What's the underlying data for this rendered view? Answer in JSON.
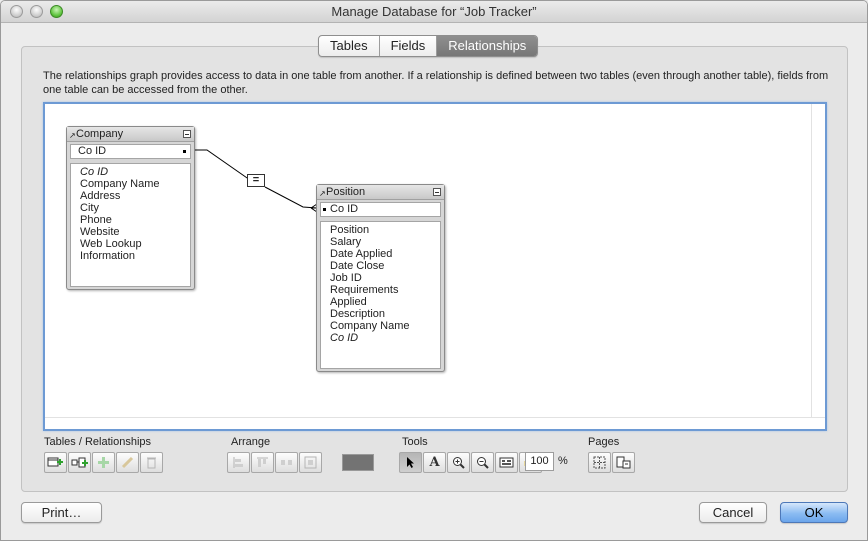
{
  "window": {
    "title": "Manage Database for “Job Tracker”"
  },
  "tabs": [
    {
      "label": "Tables",
      "active": false
    },
    {
      "label": "Fields",
      "active": false
    },
    {
      "label": "Relationships",
      "active": true
    }
  ],
  "description": "The relationships graph provides access to data in one table from another. If a relationship is defined between two tables (even through another table), fields from one table can be accessed from the other.",
  "graph": {
    "tables": [
      {
        "name": "Company",
        "key_field": "Co ID",
        "fields": [
          {
            "label": "Co ID",
            "italic": true
          },
          {
            "label": "Company Name",
            "italic": false
          },
          {
            "label": "Address",
            "italic": false
          },
          {
            "label": "City",
            "italic": false
          },
          {
            "label": "Phone",
            "italic": false
          },
          {
            "label": "Website",
            "italic": false
          },
          {
            "label": "Web Lookup",
            "italic": false
          },
          {
            "label": "Information",
            "italic": false
          }
        ]
      },
      {
        "name": "Position",
        "key_field": "Co ID",
        "fields": [
          {
            "label": "Position",
            "italic": false
          },
          {
            "label": "Salary",
            "italic": false
          },
          {
            "label": "Date Applied",
            "italic": false
          },
          {
            "label": "Date Close",
            "italic": false
          },
          {
            "label": "Job ID",
            "italic": false
          },
          {
            "label": "Requirements",
            "italic": false
          },
          {
            "label": "Applied",
            "italic": false
          },
          {
            "label": "Description",
            "italic": false
          },
          {
            "label": "Company Name",
            "italic": false
          },
          {
            "label": "Co ID",
            "italic": true
          }
        ]
      }
    ],
    "relationship_operator": "="
  },
  "toolbar": {
    "tables_relationships_label": "Tables / Relationships",
    "arrange_label": "Arrange",
    "tools_label": "Tools",
    "pages_label": "Pages",
    "swatch_color": "#737373",
    "zoom_value": "100",
    "zoom_unit": "%",
    "text_tool_glyph": "A"
  },
  "buttons": {
    "print": "Print…",
    "cancel": "Cancel",
    "ok": "OK"
  }
}
